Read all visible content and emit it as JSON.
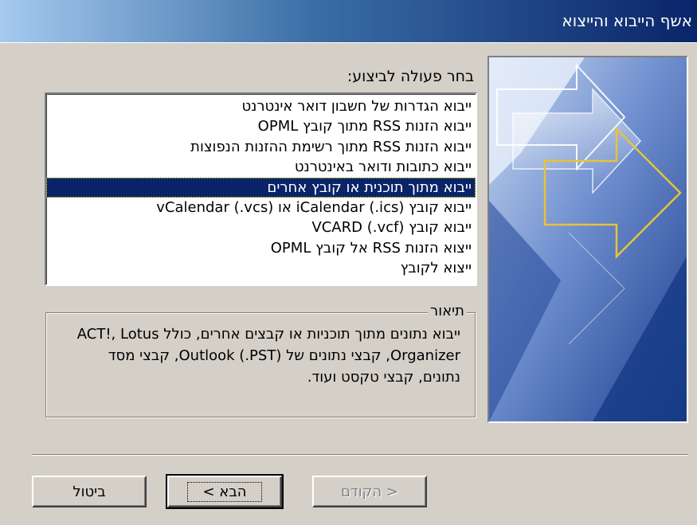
{
  "window": {
    "title": "אשף הייבוא והייצוא"
  },
  "prompt_label": "בחר פעולה לביצוע:",
  "actions": {
    "items": [
      "ייבוא הגדרות של חשבון דואר אינטרנט",
      "ייבוא הזנות RSS מתוך קובץ OPML",
      "ייבוא הזנות RSS מתוך רשימת ההזנות הנפוצות",
      "ייבוא כתובות ודואר באינטרנט",
      "ייבוא מתוך תוכנית או קובץ אחרים",
      "ייבוא קובץ iCalendar (.ics) או vCalendar (.vcs)",
      "ייבוא קובץ VCARD (.vcf)",
      "ייצוא הזנות RSS אל קובץ OPML",
      "ייצוא לקובץ"
    ],
    "selected_index": 4
  },
  "description": {
    "legend": "תיאור",
    "text": "ייבוא נתונים מתוך תוכניות או קבצים אחרים, כולל ACT!, Lotus Organizer, קבצי נתונים של Outlook (.PST), קבצי מסד נתונים, קבצי טקסט ועוד."
  },
  "buttons": {
    "back": "< הקודם",
    "next": "הבא >",
    "cancel": "ביטול"
  },
  "colors": {
    "selection": "#0a246a",
    "dialog_bg": "#d4d0c8",
    "wizard_arrow": "#e8c23a"
  }
}
